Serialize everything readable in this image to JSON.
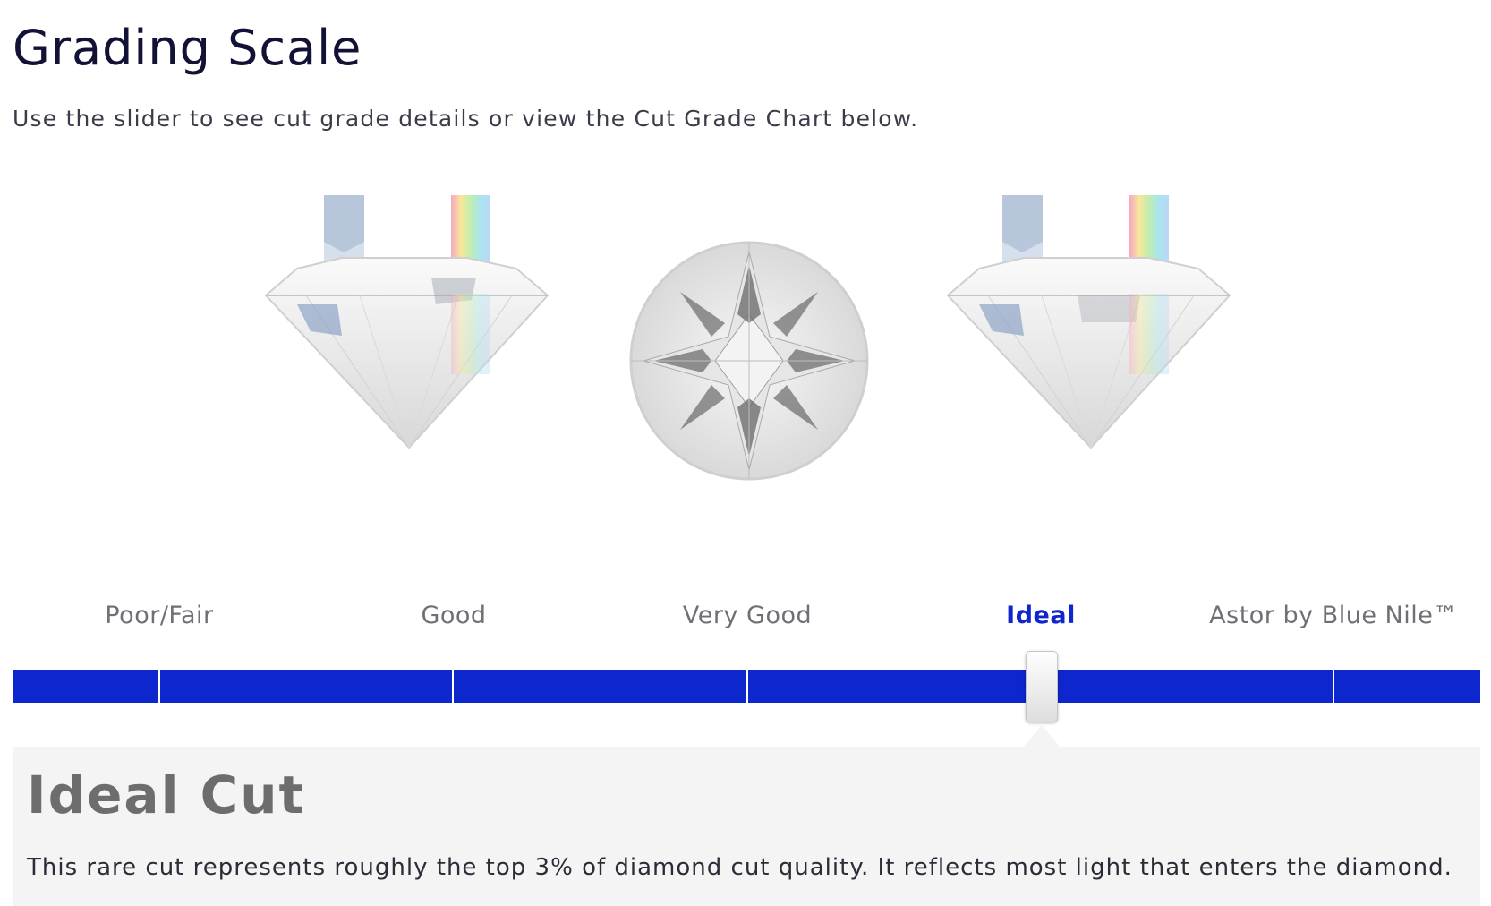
{
  "header": {
    "title": "Grading Scale",
    "subtitle": "Use the slider to see cut grade details or view the Cut Grade Chart below."
  },
  "illustrations": [
    "diamond-side-view",
    "diamond-top-view",
    "diamond-side-view"
  ],
  "slider": {
    "grades": [
      "Poor/Fair",
      "Good",
      "Very Good",
      "Ideal",
      "Astor by Blue Nile™"
    ],
    "selected": "Ideal",
    "selected_index": 3
  },
  "detail": {
    "title": "Ideal Cut",
    "description": "This rare cut represents roughly the top 3% of diamond cut quality. It reflects most light that enters the diamond."
  },
  "colors": {
    "accent": "#0e26cd",
    "title": "#121236",
    "label": "#6f6f76",
    "panel_bg": "#f4f4f4"
  }
}
